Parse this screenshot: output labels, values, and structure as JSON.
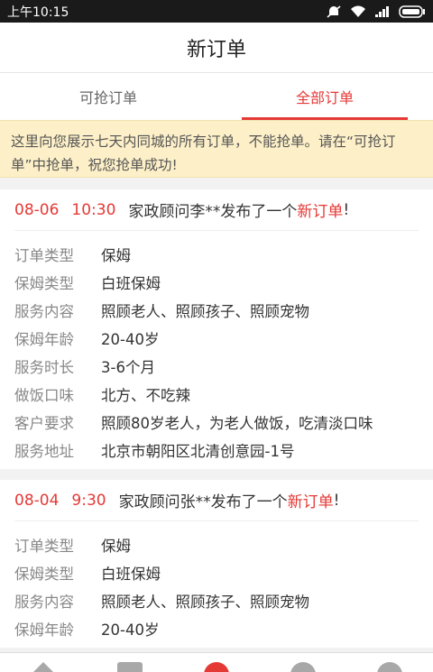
{
  "status_bar": {
    "time": "上午10:15"
  },
  "header": {
    "title": "新订单"
  },
  "tabs": [
    {
      "label": "可抢订单",
      "active": false
    },
    {
      "label": "全部订单",
      "active": true
    }
  ],
  "notice": {
    "text": "这里向您展示七天内同城的所有订单，不能抢单。请在“可抢订单”中抢单，祝您抢单成功!"
  },
  "orders": [
    {
      "date": "08-06",
      "time": "10:30",
      "text": "家政顾问李**发布了一个",
      "link": "新订单",
      "suffix": "!",
      "fields": [
        {
          "label": "订单类型",
          "value": "保姆"
        },
        {
          "label": "保姆类型",
          "value": "白班保姆"
        },
        {
          "label": "服务内容",
          "value": "照顾老人、照顾孩子、照顾宠物"
        },
        {
          "label": "保姆年龄",
          "value": "20-40岁"
        },
        {
          "label": "服务时长",
          "value": "3-6个月"
        },
        {
          "label": "做饭口味",
          "value": "北方、不吃辣"
        },
        {
          "label": "客户要求",
          "value": "照顾80岁老人，为老人做饭，吃清淡口味"
        },
        {
          "label": "服务地址",
          "value": "北京市朝阳区北清创意园-1号"
        }
      ]
    },
    {
      "date": "08-04",
      "time": "9:30",
      "text": "家政顾问张**发布了一个",
      "link": "新订单",
      "suffix": "!",
      "fields": [
        {
          "label": "订单类型",
          "value": "保姆"
        },
        {
          "label": "保姆类型",
          "value": "白班保姆"
        },
        {
          "label": "服务内容",
          "value": "照顾老人、照顾孩子、照顾宠物"
        },
        {
          "label": "保姆年龄",
          "value": "20-40岁"
        }
      ]
    }
  ],
  "bottom_nav": [
    {
      "icon": "home-icon"
    },
    {
      "icon": "list-icon"
    },
    {
      "icon": "order-icon"
    },
    {
      "icon": "edit-icon"
    },
    {
      "icon": "user-icon"
    }
  ],
  "colors": {
    "accent": "#e53935",
    "notice_bg": "#fdf0c8"
  }
}
